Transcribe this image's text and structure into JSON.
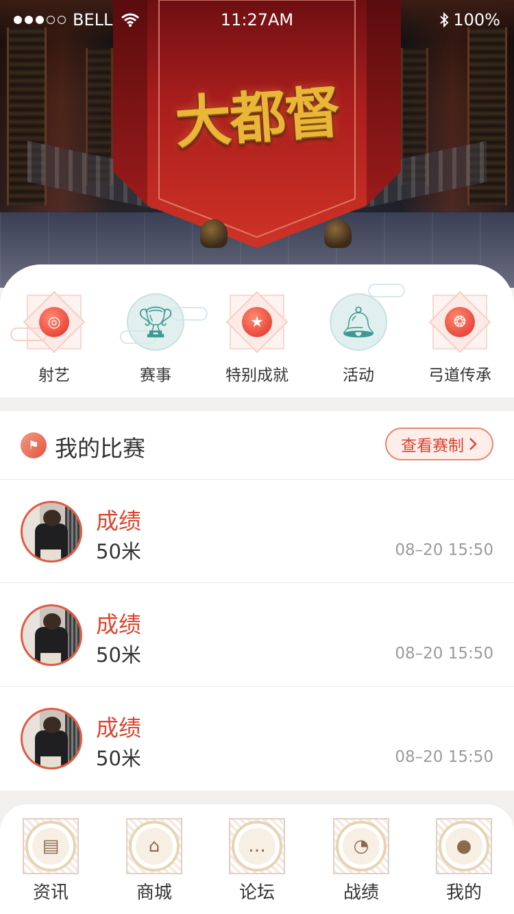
{
  "status_bar": {
    "carrier": "BELL",
    "time": "11:27AM",
    "battery": "100%"
  },
  "hero": {
    "logo_text": "大都督"
  },
  "features": [
    {
      "label": "射艺",
      "icon": "target-icon"
    },
    {
      "label": "赛事",
      "icon": "trophy-icon"
    },
    {
      "label": "特别成就",
      "icon": "medal-icon"
    },
    {
      "label": "活动",
      "icon": "bell-icon"
    },
    {
      "label": "弓道传承",
      "icon": "heritage-icon"
    }
  ],
  "matches": {
    "title": "我的比赛",
    "rules_button": "查看赛制",
    "rows": [
      {
        "label": "成绩",
        "value": "50米",
        "time": "08–20 15:50"
      },
      {
        "label": "成绩",
        "value": "50米",
        "time": "08–20 15:50"
      },
      {
        "label": "成绩",
        "value": "50米",
        "time": "08–20 15:50"
      }
    ]
  },
  "nav": [
    {
      "label": "资讯",
      "icon": "news-icon"
    },
    {
      "label": "商城",
      "icon": "store-icon"
    },
    {
      "label": "论坛",
      "icon": "forum-icon"
    },
    {
      "label": "战绩",
      "icon": "stats-icon"
    },
    {
      "label": "我的",
      "icon": "profile-icon"
    }
  ],
  "colors": {
    "accent": "#d9462f",
    "banner_red": "#b3261e",
    "gold": "#e9b638",
    "teal": "#3c9a90",
    "nav_gold": "#e6d4b3"
  }
}
